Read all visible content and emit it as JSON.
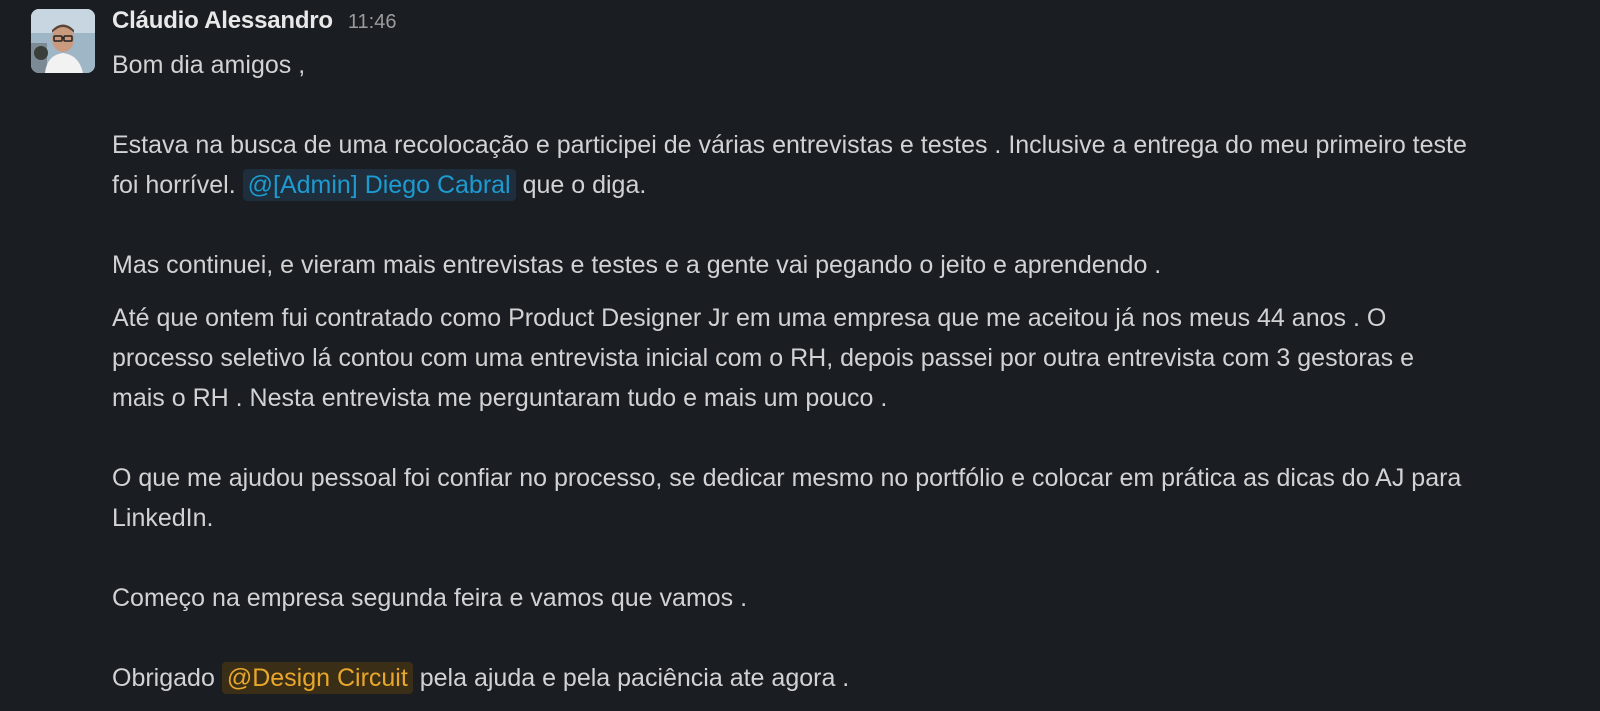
{
  "message": {
    "author": "Cláudio Alessandro",
    "timestamp": "11:46",
    "avatar_icon": "user-photo",
    "paragraphs": {
      "p1": "Bom dia amigos ,",
      "p2_line1": "Estava na busca de uma recolocação e participei de várias entrevistas e testes . Inclusive a entrega do meu primeiro teste",
      "p2_line2_before": "foi horrível.",
      "p2_mention": "@[Admin] Diego Cabral",
      "p2_line2_after": "que o diga.",
      "p3": "Mas continuei, e vieram mais entrevistas e testes e a gente vai pegando o jeito e aprendendo .",
      "p4_line1": "Até que ontem fui contratado como Product Designer Jr em uma empresa que me aceitou já nos meus 44 anos . O",
      "p4_line2": "processo seletivo lá contou com uma entrevista inicial com o RH, depois passei por outra entrevista com 3 gestoras e",
      "p4_line3": "mais o RH . Nesta entrevista me perguntaram tudo e mais um pouco .",
      "p5_line1": "O que me ajudou pessoal foi confiar no processo, se dedicar mesmo no portfólio e colocar em prática as dicas do AJ para",
      "p5_line2": "LinkedIn.",
      "p6": "Começo na empresa segunda feira e vamos que vamos .",
      "p7_before": "Obrigado",
      "p7_mention": "@Design Circuit",
      "p7_after": "pela ajuda e pela paciência ate agora ."
    }
  },
  "colors": {
    "background": "#1a1d21",
    "text": "#d1d2d3",
    "user_mention": "#1d9bd1",
    "group_mention": "#e8a72b"
  }
}
